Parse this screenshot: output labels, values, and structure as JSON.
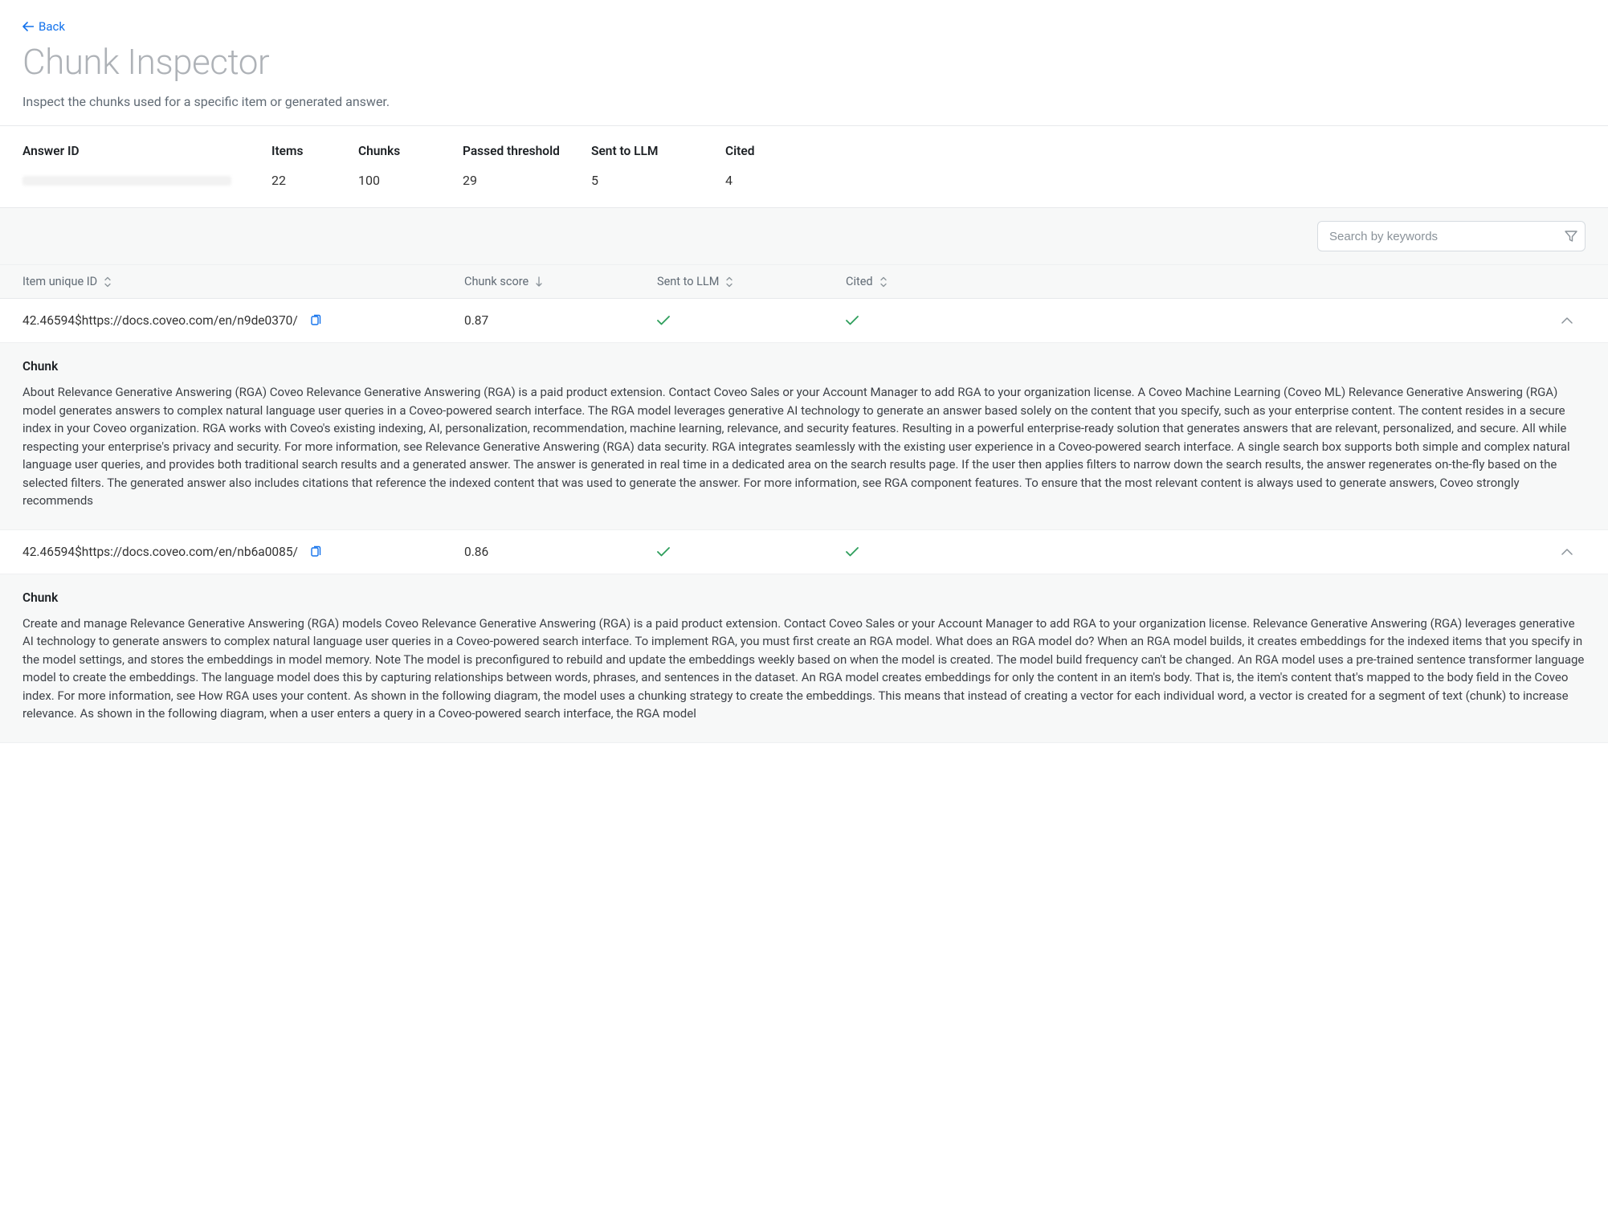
{
  "header": {
    "back_label": "Back",
    "title": "Chunk Inspector",
    "subtitle": "Inspect the chunks used for a specific item or generated answer."
  },
  "summary": {
    "labels": {
      "answer_id": "Answer ID",
      "items": "Items",
      "chunks": "Chunks",
      "passed": "Passed threshold",
      "sent": "Sent to LLM",
      "cited": "Cited"
    },
    "values": {
      "items": "22",
      "chunks": "100",
      "passed": "29",
      "sent": "5",
      "cited": "4"
    }
  },
  "search": {
    "placeholder": "Search by keywords"
  },
  "table": {
    "headers": {
      "id": "Item unique ID",
      "score": "Chunk score",
      "sent": "Sent to LLM",
      "cited": "Cited"
    },
    "rows": [
      {
        "id": "42.46594$https://docs.coveo.com/en/n9de0370/",
        "score": "0.87",
        "sent": true,
        "cited": true,
        "expanded": true,
        "chunk_label": "Chunk",
        "chunk_text": "About Relevance Generative Answering (RGA) Coveo Relevance Generative Answering (RGA) is a paid product extension. Contact Coveo Sales or your Account Manager to add RGA to your organization license. A Coveo Machine Learning (Coveo ML) Relevance Generative Answering (RGA) model generates answers to complex natural language user queries in a Coveo-powered search interface. The RGA model leverages generative AI technology to generate an answer based solely on the content that you specify, such as your enterprise content. The content resides in a secure index in your Coveo organization. RGA works with Coveo's existing indexing, AI, personalization, recommendation, machine learning, relevance, and security features. Resulting in a powerful enterprise-ready solution that generates answers that are relevant, personalized, and secure. All while respecting your enterprise's privacy and security. For more information, see Relevance Generative Answering (RGA) data security. RGA integrates seamlessly with the existing user experience in a Coveo-powered search interface. A single search box supports both simple and complex natural language user queries, and provides both traditional search results and a generated answer. The answer is generated in real time in a dedicated area on the search results page. If the user then applies filters to narrow down the search results, the answer regenerates on-the-fly based on the selected filters. The generated answer also includes citations that reference the indexed content that was used to generate the answer. For more information, see RGA component features. To ensure that the most relevant content is always used to generate answers, Coveo strongly recommends"
      },
      {
        "id": "42.46594$https://docs.coveo.com/en/nb6a0085/",
        "score": "0.86",
        "sent": true,
        "cited": true,
        "expanded": true,
        "chunk_label": "Chunk",
        "chunk_text": "Create and manage Relevance Generative Answering (RGA) models Coveo Relevance Generative Answering (RGA) is a paid product extension. Contact Coveo Sales or your Account Manager to add RGA to your organization license. Relevance Generative Answering (RGA) leverages generative AI technology to generate answers to complex natural language user queries in a Coveo-powered search interface. To implement RGA, you must first create an RGA model. What does an RGA model do? When an RGA model builds, it creates embeddings for the indexed items that you specify in the model settings, and stores the embeddings in model memory. Note The model is preconfigured to rebuild and update the embeddings weekly based on when the model is created. The model build frequency can't be changed. An RGA model uses a pre-trained sentence transformer language model to create the embeddings. The language model does this by capturing relationships between words, phrases, and sentences in the dataset. An RGA model creates embeddings for only the content in an item's body. That is, the item's content that's mapped to the body field in the Coveo index. For more information, see How RGA uses your content. As shown in the following diagram, the model uses a chunking strategy to create the embeddings. This means that instead of creating a vector for each individual word, a vector is created for a segment of text (chunk) to increase relevance. As shown in the following diagram, when a user enters a query in a Coveo-powered search interface, the RGA model"
      }
    ]
  }
}
